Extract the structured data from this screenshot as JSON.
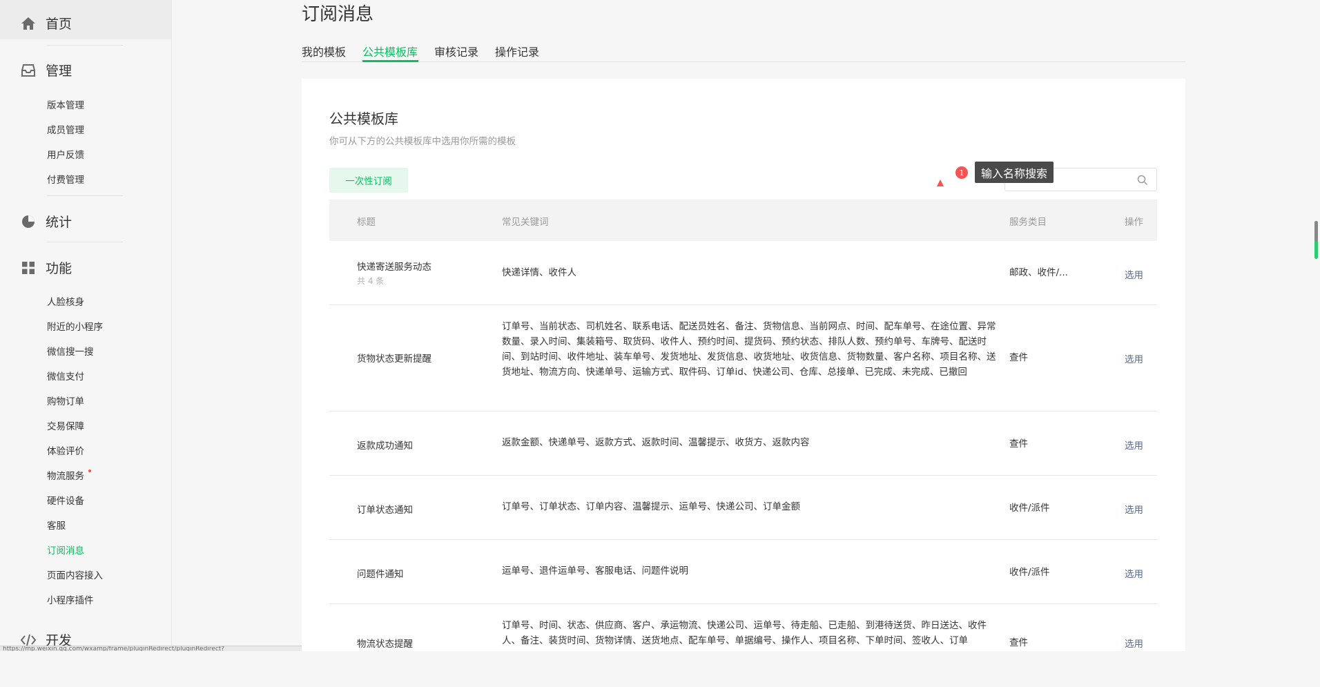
{
  "sidebar": {
    "home": "首页",
    "manage": "管理",
    "manage_items": [
      "版本管理",
      "成员管理",
      "用户反馈",
      "付费管理"
    ],
    "stats": "统计",
    "features": "功能",
    "feature_items": [
      "人脸核身",
      "附近的小程序",
      "微信搜一搜",
      "微信支付",
      "购物订单",
      "交易保障",
      "体验评价",
      "物流服务",
      "硬件设备",
      "客服",
      "订阅消息",
      "页面内容接入",
      "小程序插件"
    ],
    "dev": "开发",
    "active_item": "订阅消息"
  },
  "page": {
    "title": "订阅消息",
    "tabs": [
      "我的模板",
      "公共模板库",
      "审核记录",
      "操作记录"
    ],
    "active_tab": "公共模板库"
  },
  "card": {
    "title": "公共模板库",
    "subtitle": "你可从下方的公共模板库中选用你所需的模板",
    "once_button": "一次性订阅",
    "search_tooltip": "输入名称搜索",
    "badge": "1"
  },
  "table": {
    "headers": {
      "title": "标题",
      "keywords": "常见关键词",
      "service": "服务类目",
      "action": "操作"
    },
    "rows": [
      {
        "title": "快递寄送服务动态",
        "count": "共 4 条",
        "keywords": "快递详情、收件人",
        "service": "邮政、收件/...",
        "action": "选用"
      },
      {
        "title": "货物状态更新提醒",
        "keywords": "订单号、当前状态、司机姓名、联系电话、配送员姓名、备注、货物信息、当前网点、时间、配车单号、在途位置、异常数量、录入时间、集装箱号、取货码、收件人、预约时间、提货码、预约状态、排队人数、预约单号、车牌号、配送时间、到站时间、收件地址、装车单号、发货地址、发货信息、收货地址、收货信息、货物数量、客户名称、项目名称、送货地址、物流方向、快递单号、运输方式、取件码、订单id、快递公司、仓库、总接单、已完成、未完成、已撤回",
        "service": "查件",
        "action": "选用"
      },
      {
        "title": "返款成功通知",
        "keywords": "返款金额、快递单号、返款方式、返款时间、温馨提示、收货方、返款内容",
        "service": "查件",
        "action": "选用"
      },
      {
        "title": "订单状态通知",
        "keywords": "订单号、订单状态、订单内容、温馨提示、运单号、快递公司、订单金额",
        "service": "收件/派件",
        "action": "选用"
      },
      {
        "title": "问题件通知",
        "keywords": "运单号、退件运单号、客服电话、问题件说明",
        "service": "收件/派件",
        "action": "选用"
      },
      {
        "title": "物流状态提醒",
        "keywords": "订单号、时间、状态、供应商、客户、承运物流、快递公司、运单号、待走船、已走船、到港待送货、昨日送达、收件人、备注、装货时间、货物详情、送货地点、配车单号、单据编号、操作人、项目名称、下单时间、签收人、订单",
        "service": "查件",
        "action": "选用"
      }
    ]
  },
  "statusbar": "https://mp.weixin.qq.com/wxamp/frame/pluginRedirect/pluginRedirect?plugin_uin=1645020513&lang=zh_CN"
}
